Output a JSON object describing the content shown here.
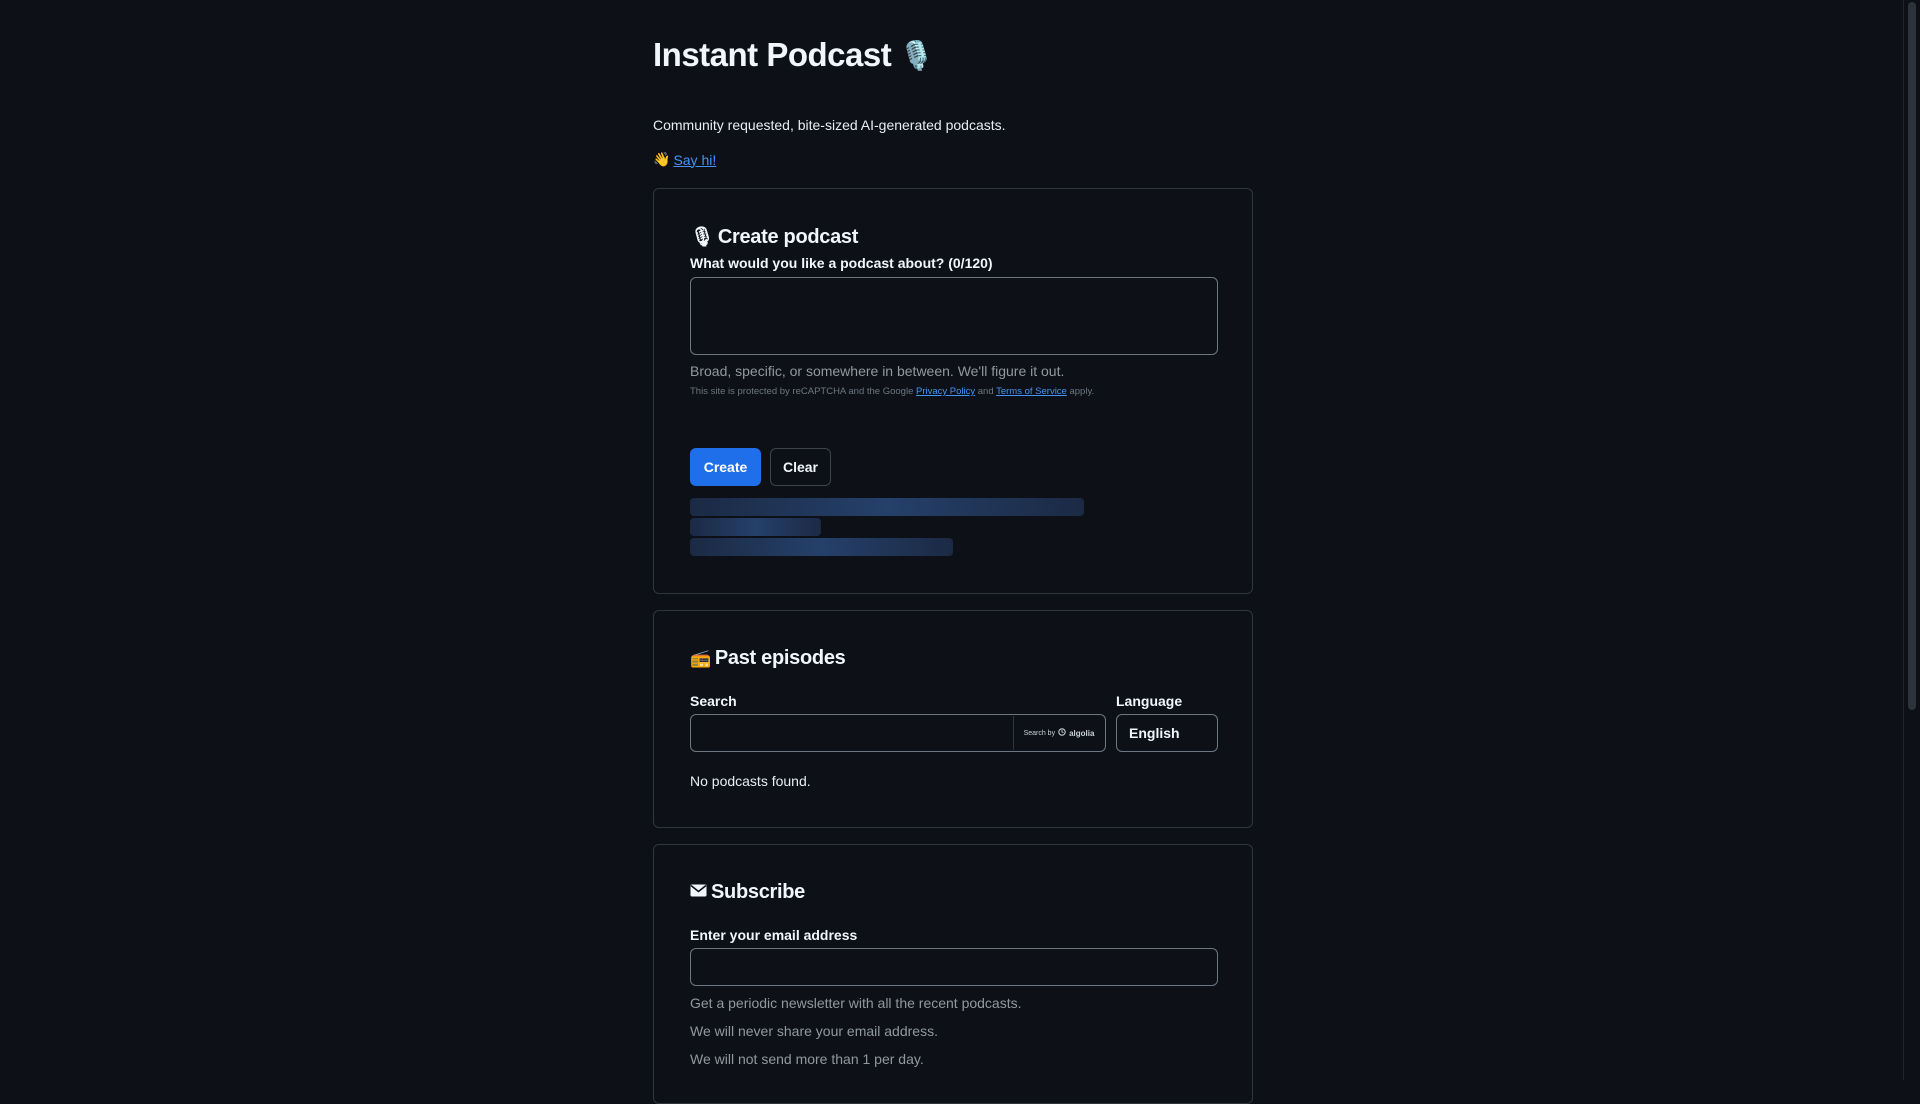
{
  "header": {
    "title": "Instant Podcast",
    "title_emoji": "🎙️",
    "tagline": "Community requested, bite-sized AI-generated podcasts.",
    "say_hi_emoji": "👋",
    "say_hi_label": "Say hi!"
  },
  "create": {
    "title": "Create podcast",
    "title_emoji": "🎙",
    "prompt_label": "What would you like a podcast about? (0/120)",
    "prompt_value": "",
    "hint": "Broad, specific, or somewhere in between. We'll figure it out.",
    "recaptcha_prefix": "This site is protected by reCAPTCHA and the Google",
    "privacy_label": "Privacy Policy",
    "and_label": "and",
    "terms_label": "Terms of Service",
    "apply_label": "apply.",
    "create_label": "Create",
    "clear_label": "Clear"
  },
  "past": {
    "title": "Past episodes",
    "title_emoji": "📻",
    "search_label": "Search",
    "search_value": "",
    "search_by": "Search by",
    "algolia": "algolia",
    "language_label": "Language",
    "language_value": "English",
    "empty_message": "No podcasts found."
  },
  "subscribe": {
    "title": "Subscribe",
    "title_emoji": "✉️",
    "email_label": "Enter your email address",
    "email_value": "",
    "notes": [
      "Get a periodic newsletter with all the recent podcasts.",
      "We will never share your email address.",
      "We will not send more than 1 per day."
    ]
  },
  "colors": {
    "background": "#0d1117",
    "accent": "#1f6feb",
    "link": "#4493f8",
    "border": "#30363d"
  }
}
